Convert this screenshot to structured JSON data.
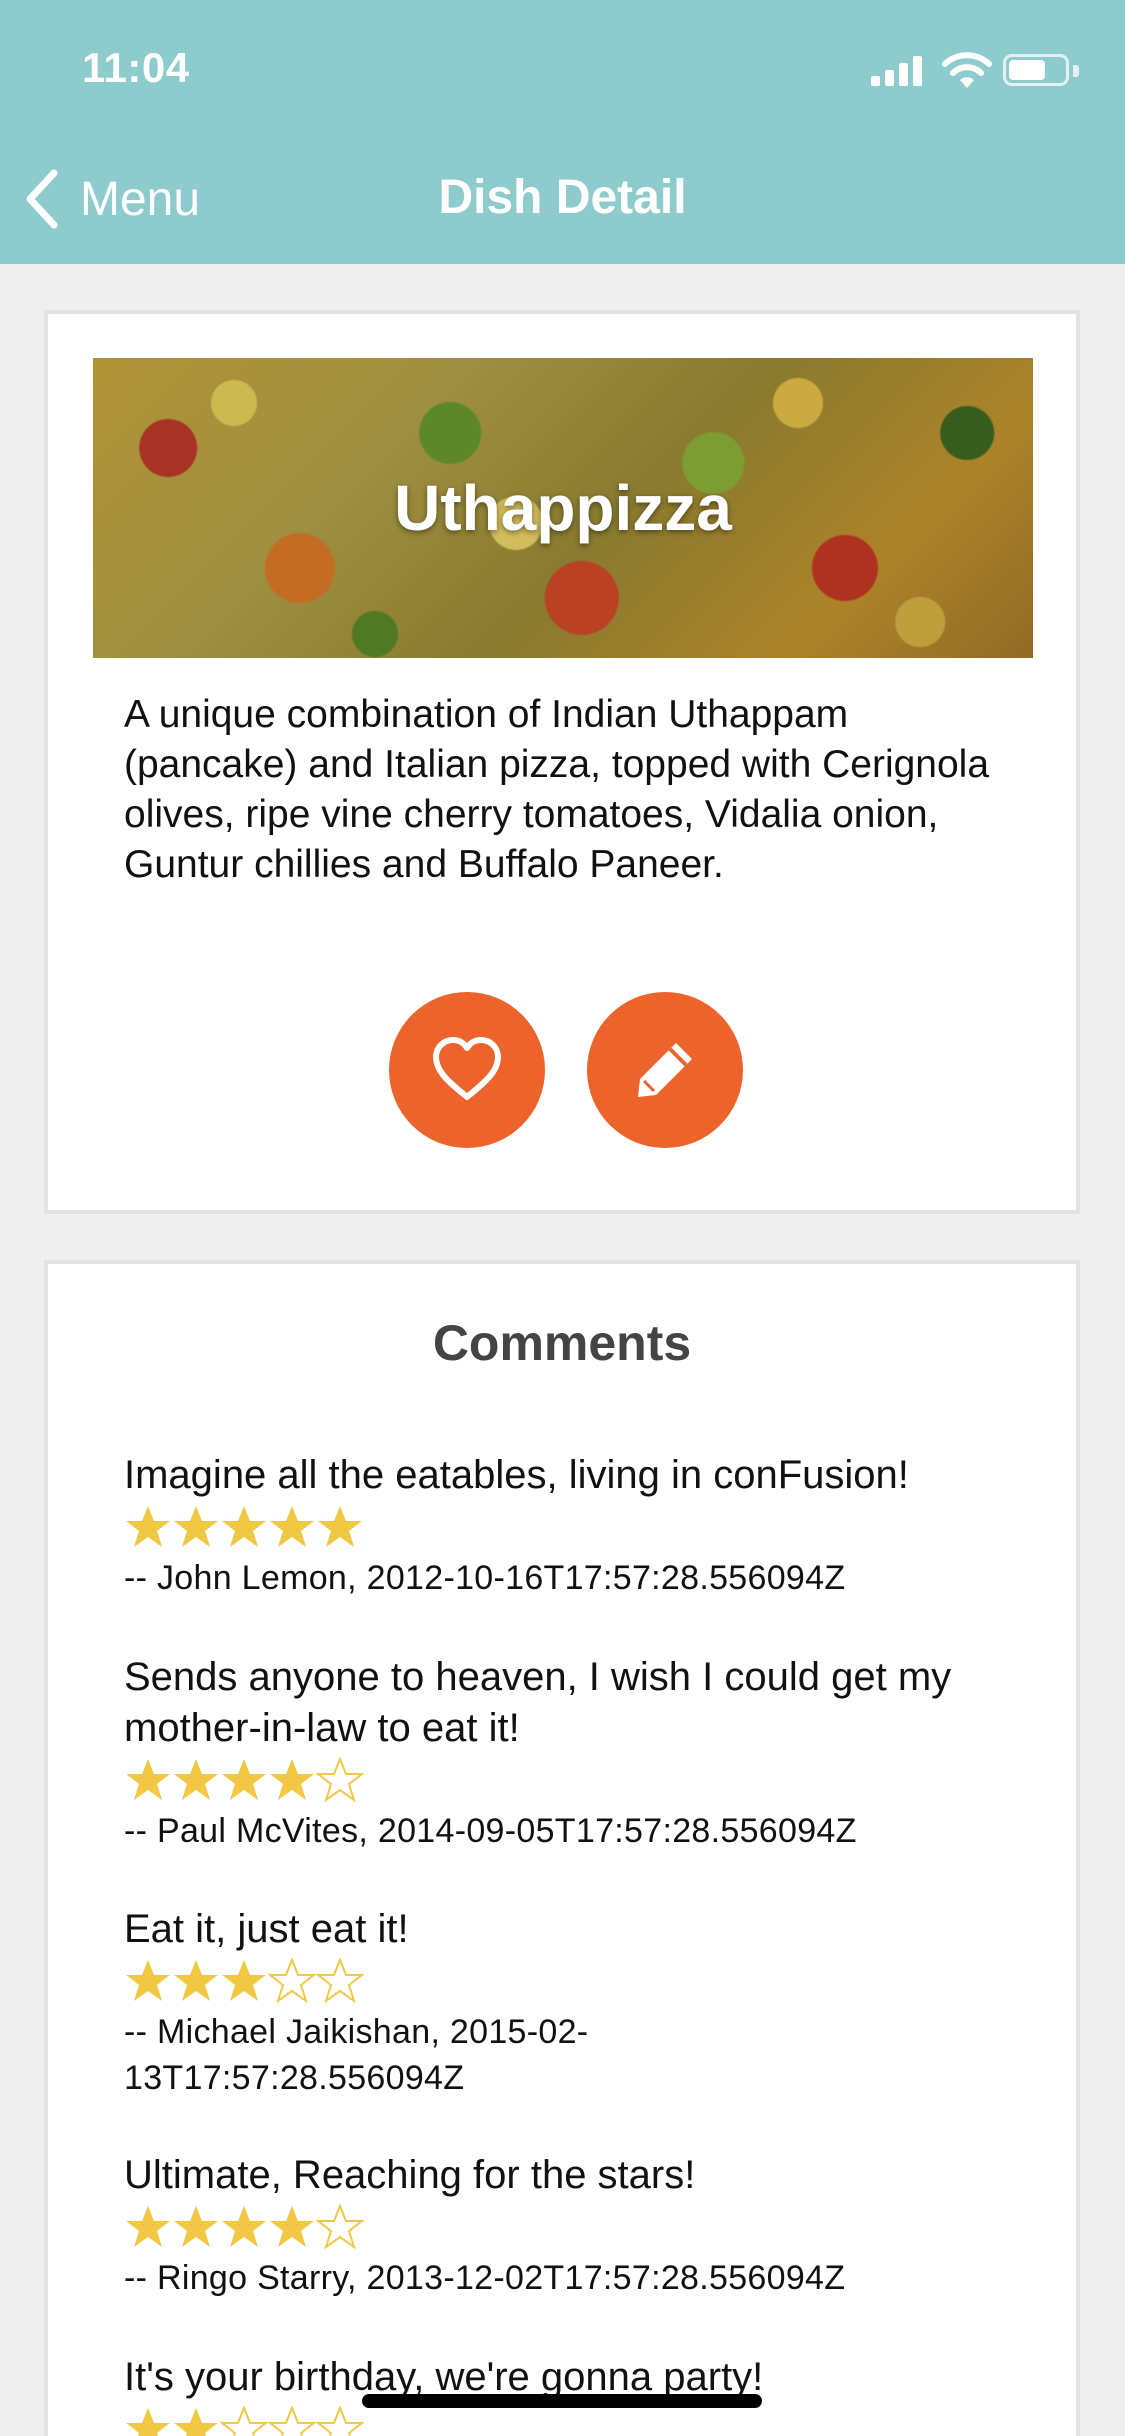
{
  "status_bar": {
    "time": "11:04"
  },
  "nav": {
    "back_label": "Menu",
    "title": "Dish Detail"
  },
  "dish": {
    "name": "Uthappizza",
    "description": "A unique combination of Indian Uthappam (pancake) and Italian pizza, topped with Cerignola olives, ripe vine cherry tomatoes, Vidalia onion, Guntur chillies and Buffalo Paneer.",
    "favorite_icon": "heart-outline-icon",
    "edit_icon": "pencil-icon"
  },
  "comments": {
    "title": "Comments",
    "items": [
      {
        "text": "Imagine all the eatables, living in conFusion!",
        "rating": 5,
        "meta": "-- John Lemon, 2012-10-16T17:57:28.556094Z"
      },
      {
        "text": "Sends anyone to heaven, I wish I could get my mother-in-law to eat it!",
        "rating": 4,
        "meta": "-- Paul McVites, 2014-09-05T17:57:28.556094Z"
      },
      {
        "text": "Eat it, just eat it!",
        "rating": 3,
        "meta": "-- Michael Jaikishan, 2015-02-13T17:57:28.556094Z"
      },
      {
        "text": "Ultimate, Reaching for the stars!",
        "rating": 4,
        "meta": "-- Ringo Starry, 2013-12-02T17:57:28.556094Z"
      },
      {
        "text": "It's your birthday, we're gonna party!",
        "rating": 2,
        "meta": ""
      }
    ]
  },
  "colors": {
    "header": "#8dcbcc",
    "accent": "#ec642c",
    "star": "#f2c744",
    "background": "#efefef"
  }
}
